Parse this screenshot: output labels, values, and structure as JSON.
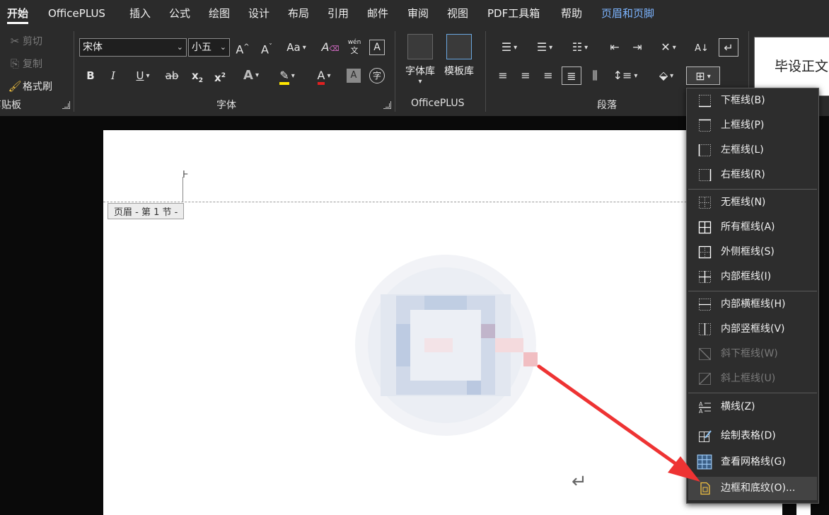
{
  "menu_tabs": [
    "开始",
    "OfficePLUS",
    "插入",
    "公式",
    "绘图",
    "设计",
    "布局",
    "引用",
    "邮件",
    "审阅",
    "视图",
    "PDF工具箱",
    "帮助",
    "页眉和页脚"
  ],
  "clipboard": {
    "cut": "剪切",
    "copy": "复制",
    "format_painter": "格式刷",
    "group_label": "剪贴板"
  },
  "font": {
    "name": "宋体",
    "size": "小五",
    "grow": "A",
    "shrink": "A",
    "change_case": "Aa",
    "bold": "B",
    "italic": "I",
    "underline": "U",
    "strikethrough": "ab",
    "subscript": "x",
    "superscript": "x",
    "text_effects": "A",
    "font_color": "A",
    "char_shading": "A",
    "enclose": "字",
    "phonetic_top": "wén",
    "phonetic_bottom": "文",
    "group_label": "字体"
  },
  "officeplus": {
    "font_library": "字体库",
    "template_library": "模板库",
    "group_label": "OfficePLUS"
  },
  "paragraph": {
    "group_label": "段落"
  },
  "styles": {
    "sample": "毕设正文"
  },
  "document": {
    "header_tag": "页眉 - 第 1 节 -",
    "header_tag_right": "眉"
  },
  "borders_menu": {
    "items": [
      {
        "label": "下框线(B)",
        "icon": "border-bottom-icon",
        "enabled": true
      },
      {
        "label": "上框线(P)",
        "icon": "border-top-icon",
        "enabled": true
      },
      {
        "label": "左框线(L)",
        "icon": "border-left-icon",
        "enabled": true
      },
      {
        "label": "右框线(R)",
        "icon": "border-right-icon",
        "enabled": true
      },
      {
        "label": "无框线(N)",
        "icon": "border-none-icon",
        "enabled": true
      },
      {
        "label": "所有框线(A)",
        "icon": "border-all-icon",
        "enabled": true
      },
      {
        "label": "外侧框线(S)",
        "icon": "border-outside-icon",
        "enabled": true
      },
      {
        "label": "内部框线(I)",
        "icon": "border-inside-icon",
        "enabled": true
      },
      {
        "label": "内部横框线(H)",
        "icon": "border-inside-horizontal-icon",
        "enabled": true
      },
      {
        "label": "内部竖框线(V)",
        "icon": "border-inside-vertical-icon",
        "enabled": true
      },
      {
        "label": "斜下框线(W)",
        "icon": "border-diagonal-down-icon",
        "enabled": false
      },
      {
        "label": "斜上框线(U)",
        "icon": "border-diagonal-up-icon",
        "enabled": false
      },
      {
        "label": "横线(Z)",
        "icon": "horizontal-line-icon",
        "enabled": true
      },
      {
        "label": "绘制表格(D)",
        "icon": "draw-table-icon",
        "enabled": true
      },
      {
        "label": "查看网格线(G)",
        "icon": "view-gridlines-icon",
        "enabled": true
      },
      {
        "label": "边框和底纹(O)...",
        "icon": "borders-shading-icon",
        "enabled": true
      }
    ]
  },
  "colors": {
    "accent_blue": "#7cb4ff",
    "highlight_yellow": "#ffe600",
    "font_red": "#e02020",
    "arrow_red": "#ee3333"
  }
}
